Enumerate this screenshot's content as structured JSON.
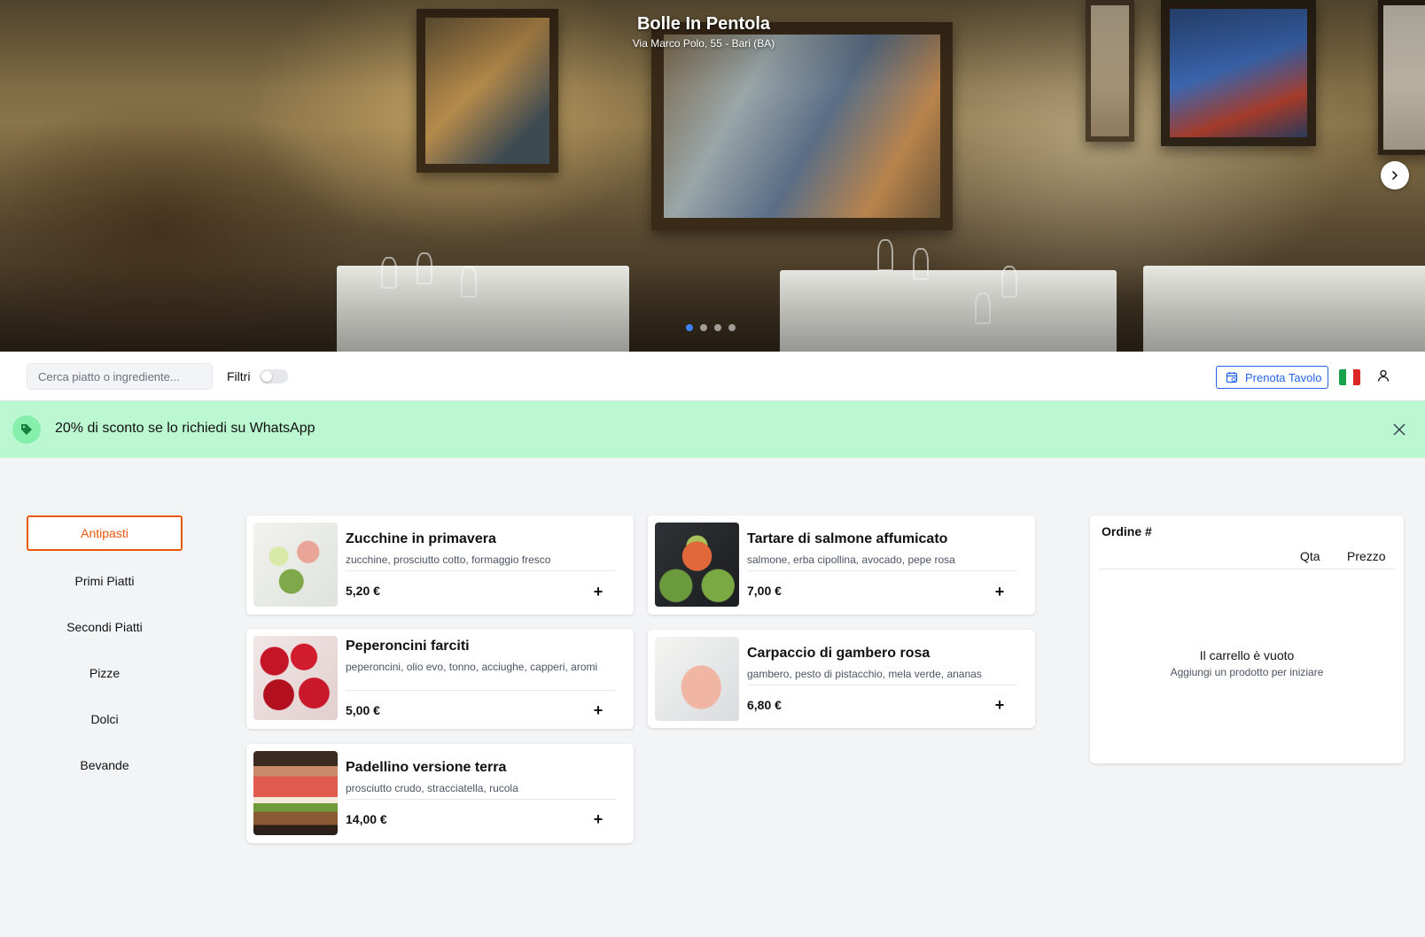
{
  "hero": {
    "title": "Bolle In Pentola",
    "address": "Via Marco Polo, 55 - Bari (BA)",
    "slides_total": 4,
    "active_slide": 1,
    "next_icon": "chevron-right-icon"
  },
  "toolbar": {
    "search_placeholder": "Cerca piatto o ingrediente...",
    "filters_label": "Filtri",
    "filters_enabled": false,
    "book_label": "Prenota Tavolo",
    "book_icon": "calendar-icon",
    "language_flag": "italian-flag-icon",
    "user_icon": "user-icon",
    "accent_color": "#2563eb"
  },
  "promo": {
    "text": "20% di sconto se lo richiedi su WhatsApp",
    "icon": "tag-icon",
    "close_icon": "close-icon",
    "background": "#bbf7d0"
  },
  "categories": [
    {
      "label": "Antipasti",
      "active": true
    },
    {
      "label": "Primi Piatti",
      "active": false
    },
    {
      "label": "Secondi Piatti",
      "active": false
    },
    {
      "label": "Pizze",
      "active": false
    },
    {
      "label": "Dolci",
      "active": false
    },
    {
      "label": "Bevande",
      "active": false
    }
  ],
  "category_accent": "#ea580c",
  "products": [
    {
      "name": "Zucchine in primavera",
      "ingredients": "zucchine, prosciutto cotto, formaggio fresco",
      "price": "5,20 €"
    },
    {
      "name": "Tartare di salmone affumicato",
      "ingredients": "salmone, erba cipollina, avocado, pepe rosa",
      "price": "7,00 €"
    },
    {
      "name": "Peperoncini farciti",
      "ingredients": "peperoncini, olio evo, tonno, acciughe, capperi, aromi",
      "price": "5,00 €"
    },
    {
      "name": "Carpaccio di gambero rosa",
      "ingredients": "gambero, pesto di pistacchio, mela verde, ananas",
      "price": "6,80 €"
    },
    {
      "name": "Padellino versione terra",
      "ingredients": "prosciutto crudo, stracciatella, rucola",
      "price": "14,00 €"
    }
  ],
  "add_symbol": "+",
  "order": {
    "title": "Ordine #",
    "qty_header": "Qta",
    "price_header": "Prezzo",
    "empty_title": "Il carrello è vuoto",
    "empty_hint": "Aggiungi un prodotto per iniziare"
  }
}
